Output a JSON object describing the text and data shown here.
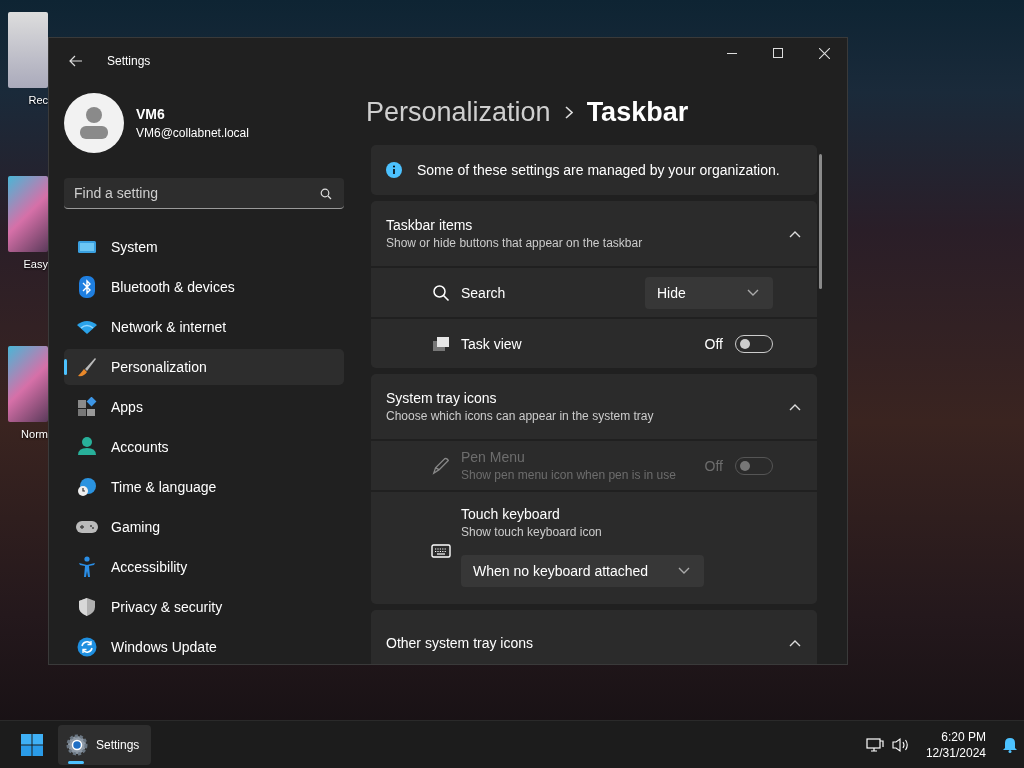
{
  "desktop_icons": [
    {
      "label": "Rec",
      "kind": "bin"
    },
    {
      "label": "Easy",
      "kind": "art"
    },
    {
      "label": "Norm",
      "kind": "art"
    }
  ],
  "window": {
    "title": "Settings"
  },
  "account": {
    "name": "VM6",
    "email": "VM6@collabnet.local"
  },
  "search": {
    "placeholder": "Find a setting"
  },
  "nav": [
    {
      "label": "System",
      "kind": "system",
      "selected": false
    },
    {
      "label": "Bluetooth & devices",
      "kind": "bluetooth",
      "selected": false
    },
    {
      "label": "Network & internet",
      "kind": "network",
      "selected": false
    },
    {
      "label": "Personalization",
      "kind": "brush",
      "selected": true
    },
    {
      "label": "Apps",
      "kind": "apps",
      "selected": false
    },
    {
      "label": "Accounts",
      "kind": "account",
      "selected": false
    },
    {
      "label": "Time & language",
      "kind": "time",
      "selected": false
    },
    {
      "label": "Gaming",
      "kind": "gaming",
      "selected": false
    },
    {
      "label": "Accessibility",
      "kind": "accessibility",
      "selected": false
    },
    {
      "label": "Privacy & security",
      "kind": "shield",
      "selected": false
    },
    {
      "label": "Windows Update",
      "kind": "update",
      "selected": false
    }
  ],
  "breadcrumb": {
    "parent": "Personalization",
    "current": "Taskbar"
  },
  "notice": "Some of these settings are managed by your organization.",
  "sections": [
    {
      "title": "Taskbar items",
      "subtitle": "Show or hide buttons that appear on the taskbar",
      "expanded": true,
      "rows": [
        {
          "kind": "dropdown",
          "label": "Search",
          "value": "Hide",
          "disabled": false
        },
        {
          "kind": "toggle",
          "label": "Task view",
          "state_text": "Off",
          "on": false,
          "disabled": false
        }
      ]
    },
    {
      "title": "System tray icons",
      "subtitle": "Choose which icons can appear in the system tray",
      "expanded": true,
      "rows": [
        {
          "kind": "toggle",
          "label": "Pen Menu",
          "description": "Show pen menu icon when pen is in use",
          "state_text": "Off",
          "on": false,
          "disabled": true
        },
        {
          "kind": "dropdown_below",
          "label": "Touch keyboard",
          "description": "Show touch keyboard icon",
          "value": "When no keyboard attached",
          "disabled": false
        }
      ]
    },
    {
      "title": "Other system tray icons",
      "expanded": true
    }
  ],
  "taskbar": {
    "apps": [
      {
        "label": "Settings",
        "selected": true
      }
    ],
    "time": "6:20 PM",
    "date": "12/31/2024"
  }
}
